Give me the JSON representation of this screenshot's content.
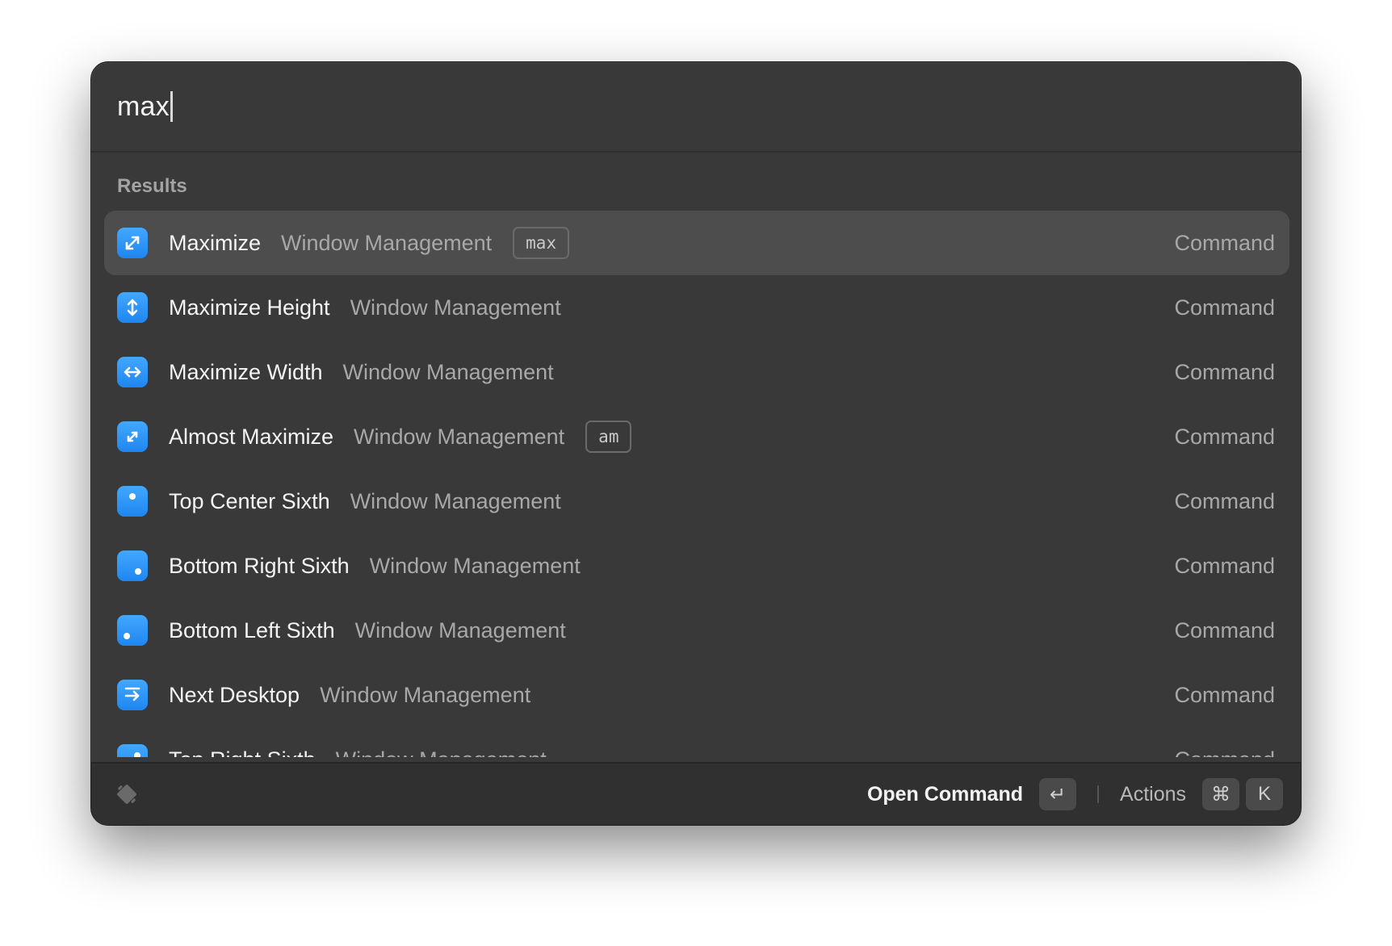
{
  "search": {
    "query": "max"
  },
  "section": {
    "label": "Results"
  },
  "results": [
    {
      "title": "Maximize",
      "subtitle": "Window Management",
      "alias": "max",
      "type": "Command",
      "icon": "maximize-icon",
      "selected": true
    },
    {
      "title": "Maximize Height",
      "subtitle": "Window Management",
      "alias": "",
      "type": "Command",
      "icon": "maximize-height-icon"
    },
    {
      "title": "Maximize Width",
      "subtitle": "Window Management",
      "alias": "",
      "type": "Command",
      "icon": "maximize-width-icon"
    },
    {
      "title": "Almost Maximize",
      "subtitle": "Window Management",
      "alias": "am",
      "type": "Command",
      "icon": "almost-maximize-icon"
    },
    {
      "title": "Top Center Sixth",
      "subtitle": "Window Management",
      "alias": "",
      "type": "Command",
      "icon": "top-center-sixth-icon"
    },
    {
      "title": "Bottom Right Sixth",
      "subtitle": "Window Management",
      "alias": "",
      "type": "Command",
      "icon": "bottom-right-sixth-icon"
    },
    {
      "title": "Bottom Left Sixth",
      "subtitle": "Window Management",
      "alias": "",
      "type": "Command",
      "icon": "bottom-left-sixth-icon"
    },
    {
      "title": "Next Desktop",
      "subtitle": "Window Management",
      "alias": "",
      "type": "Command",
      "icon": "next-desktop-icon"
    },
    {
      "title": "Top Right Sixth",
      "subtitle": "Window Management",
      "alias": "",
      "type": "Command",
      "icon": "top-right-sixth-icon"
    }
  ],
  "footer": {
    "logo_icon": "raycast-logo-icon",
    "primary_action": "Open Command",
    "enter_key": "↵",
    "actions_label": "Actions",
    "cmd_key": "⌘",
    "k_key": "K"
  },
  "colors": {
    "window_bg": "#393939",
    "selected_row": "#4d4d4d",
    "icon_blue": "#2b95f7",
    "footer_bg": "#303030"
  }
}
